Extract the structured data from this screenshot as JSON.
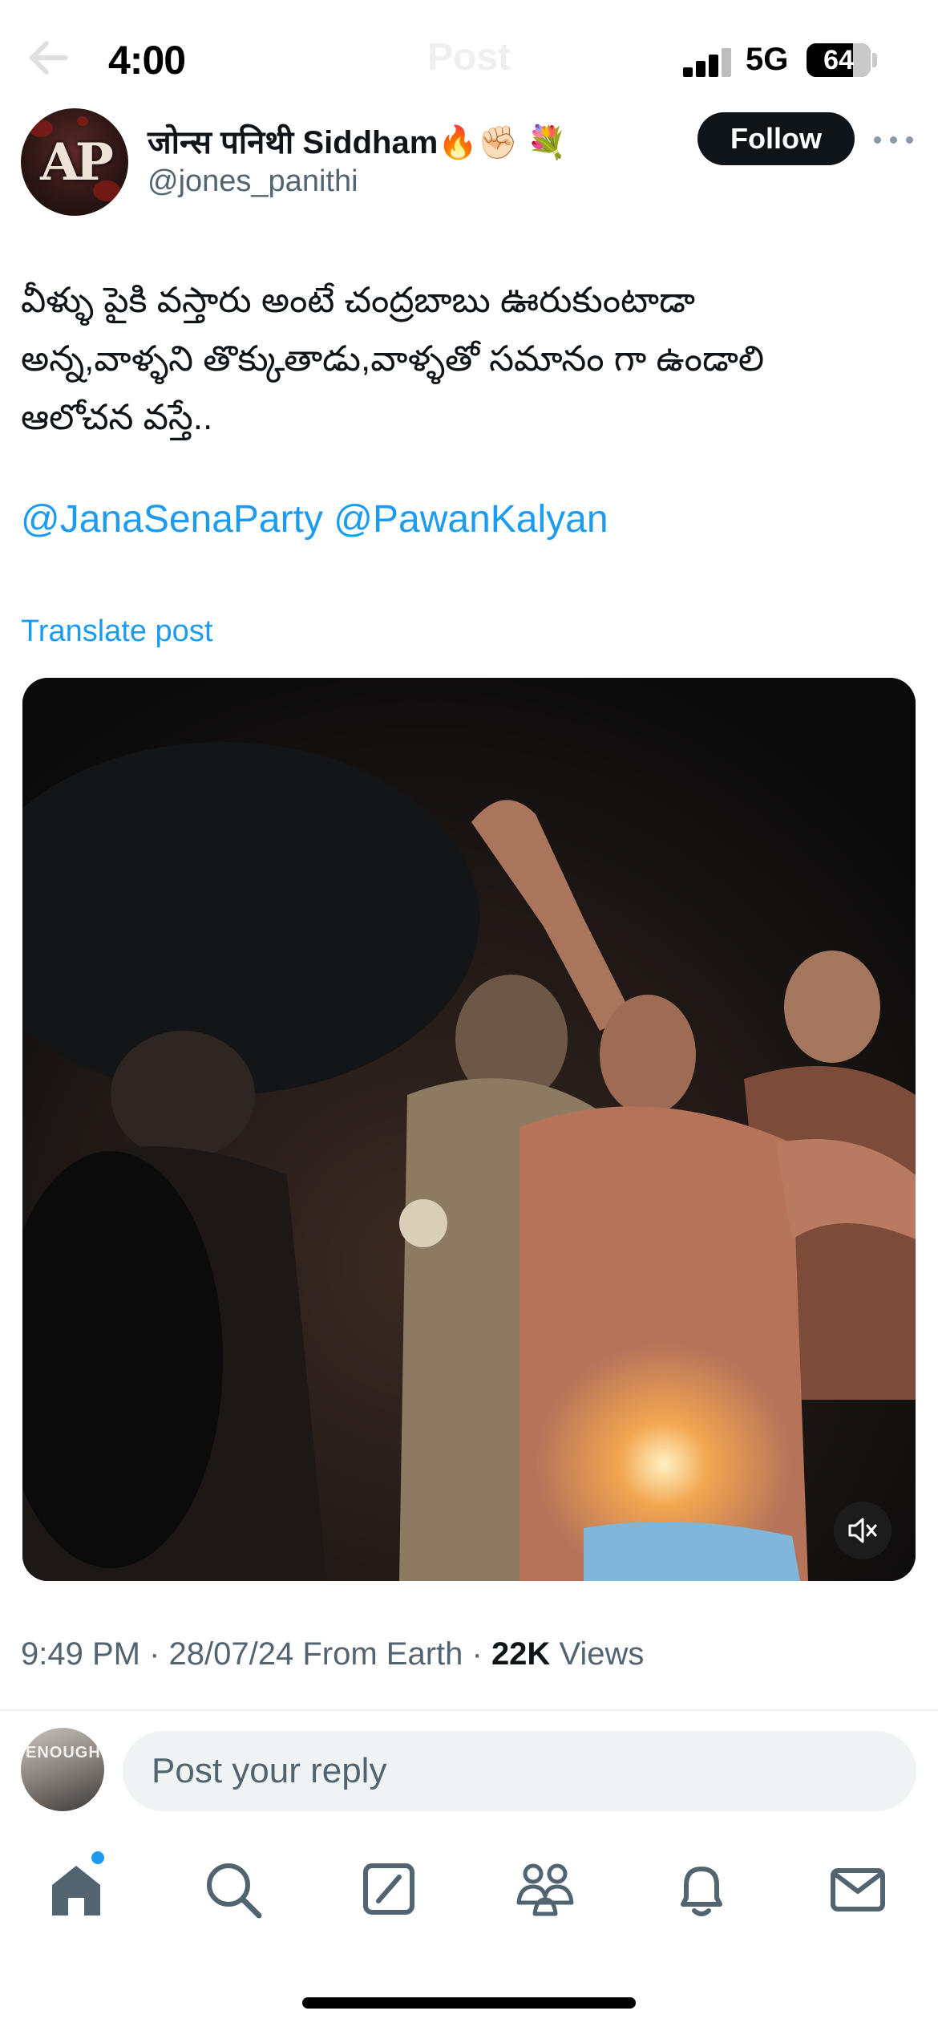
{
  "status_bar": {
    "time": "4:00",
    "network": "5G",
    "battery": "64"
  },
  "header": {
    "title": "Post"
  },
  "author": {
    "display_name": "जोन्स पनिथी Siddham🔥✊🏻 💐",
    "handle": "@jones_panithi",
    "avatar_text": "AP",
    "follow_label": "Follow"
  },
  "post": {
    "lines": [
      "వీళ్ళు పైకి వస్తారు అంటే చంద్రబాబు ఊరుకుంటాడా",
      "అన్న,వాళ్ళని తొక్కుతాడు,వాళ్ళతో సమానం గా ఉండాలి",
      "ఆలోచన వస్తే.."
    ],
    "mentions": [
      "@JanaSenaParty",
      "@PawanKalyan"
    ],
    "translate_label": "Translate post"
  },
  "media": {
    "type": "video",
    "muted": true
  },
  "meta": {
    "time": "9:49 PM",
    "date": "28/07/24",
    "source": "From Earth",
    "views_count": "22K",
    "views_label": "Views"
  },
  "reply": {
    "avatar_text": "ENOUGH",
    "placeholder": "Post your reply"
  },
  "nav": {
    "items": [
      "home-icon",
      "search-icon",
      "grok-icon",
      "communities-icon",
      "notifications-icon",
      "messages-icon"
    ],
    "home_has_badge": true
  }
}
